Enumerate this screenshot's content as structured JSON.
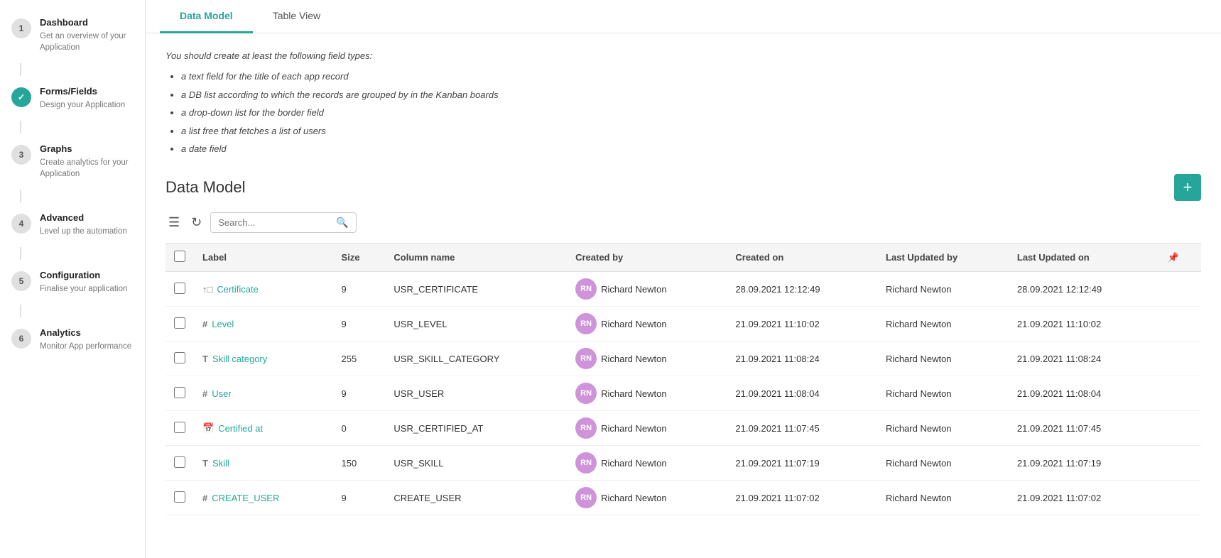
{
  "sidebar": {
    "items": [
      {
        "id": "dashboard",
        "step": "1",
        "title": "Dashboard",
        "desc": "Get an overview of your Application",
        "state": "default"
      },
      {
        "id": "forms-fields",
        "step": "✓",
        "title": "Forms/Fields",
        "desc": "Design your Application",
        "state": "completed"
      },
      {
        "id": "graphs",
        "step": "3",
        "title": "Graphs",
        "desc": "Create analytics for your Application",
        "state": "default"
      },
      {
        "id": "advanced",
        "step": "4",
        "title": "Advanced",
        "desc": "Level up the automation",
        "state": "default"
      },
      {
        "id": "configuration",
        "step": "5",
        "title": "Configuration",
        "desc": "Finalise your application",
        "state": "default"
      },
      {
        "id": "analytics",
        "step": "6",
        "title": "Analytics",
        "desc": "Monitor App performance",
        "state": "default"
      }
    ]
  },
  "tabs": [
    {
      "id": "data-model",
      "label": "Data Model",
      "active": true
    },
    {
      "id": "table-view",
      "label": "Table View",
      "active": false
    }
  ],
  "instructions": {
    "intro": "You should create at least the following field types:",
    "items": [
      "a text field for the title of each app record",
      "a DB list according to which the records are grouped by in the Kanban boards",
      "a drop-down list for the border field",
      "a list free that fetches a list of users",
      "a date field"
    ]
  },
  "section": {
    "title": "Data Model",
    "add_button": "+"
  },
  "toolbar": {
    "search_placeholder": "Search..."
  },
  "table": {
    "columns": [
      "",
      "Label",
      "Size",
      "Column name",
      "Created by",
      "Created on",
      "Last Updated by",
      "Last Updated on",
      "📌"
    ],
    "rows": [
      {
        "type_icon": "↑□",
        "label": "Certificate",
        "size": "9",
        "column_name": "USR_CERTIFICATE",
        "created_by_initials": "RN",
        "created_by_name": "Richard Newton",
        "created_on": "28.09.2021 12:12:49",
        "last_updated_by": "Richard Newton",
        "last_updated_on": "28.09.2021 12:12:49"
      },
      {
        "type_icon": "#",
        "label": "Level",
        "size": "9",
        "column_name": "USR_LEVEL",
        "created_by_initials": "RN",
        "created_by_name": "Richard Newton",
        "created_on": "21.09.2021 11:10:02",
        "last_updated_by": "Richard Newton",
        "last_updated_on": "21.09.2021 11:10:02"
      },
      {
        "type_icon": "T",
        "label": "Skill category",
        "size": "255",
        "column_name": "USR_SKILL_CATEGORY",
        "created_by_initials": "RN",
        "created_by_name": "Richard Newton",
        "created_on": "21.09.2021 11:08:24",
        "last_updated_by": "Richard Newton",
        "last_updated_on": "21.09.2021 11:08:24"
      },
      {
        "type_icon": "#",
        "label": "User",
        "size": "9",
        "column_name": "USR_USER",
        "created_by_initials": "RN",
        "created_by_name": "Richard Newton",
        "created_on": "21.09.2021 11:08:04",
        "last_updated_by": "Richard Newton",
        "last_updated_on": "21.09.2021 11:08:04"
      },
      {
        "type_icon": "📅",
        "label": "Certified at",
        "size": "0",
        "column_name": "USR_CERTIFIED_AT",
        "created_by_initials": "RN",
        "created_by_name": "Richard Newton",
        "created_on": "21.09.2021 11:07:45",
        "last_updated_by": "Richard Newton",
        "last_updated_on": "21.09.2021 11:07:45"
      },
      {
        "type_icon": "T",
        "label": "Skill",
        "size": "150",
        "column_name": "USR_SKILL",
        "created_by_initials": "RN",
        "created_by_name": "Richard Newton",
        "created_on": "21.09.2021 11:07:19",
        "last_updated_by": "Richard Newton",
        "last_updated_on": "21.09.2021 11:07:19"
      },
      {
        "type_icon": "#",
        "label": "CREATE_USER",
        "size": "9",
        "column_name": "CREATE_USER",
        "created_by_initials": "RN",
        "created_by_name": "Richard Newton",
        "created_on": "21.09.2021 11:07:02",
        "last_updated_by": "Richard Newton",
        "last_updated_on": "21.09.2021 11:07:02"
      }
    ]
  }
}
